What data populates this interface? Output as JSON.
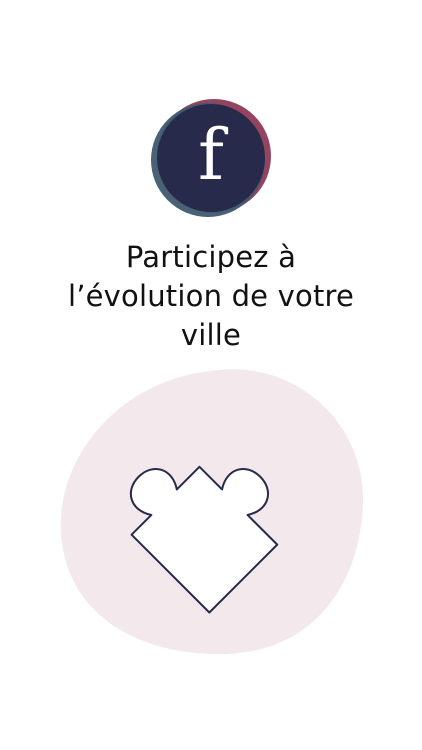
{
  "logo": {
    "letter": "f",
    "colors": {
      "core": "#272a4a",
      "petal_red": "#8e3a59",
      "petal_teal": "#3f5a6f"
    }
  },
  "headline": {
    "lines": [
      "Participez à",
      "l’évolution de votre",
      "ville"
    ]
  },
  "illustration": {
    "icon": "puzzle-piece-icon",
    "colors": {
      "blob": "#f3e9ed",
      "outline": "#272a4a",
      "shadow": "#e6e6ea"
    }
  }
}
